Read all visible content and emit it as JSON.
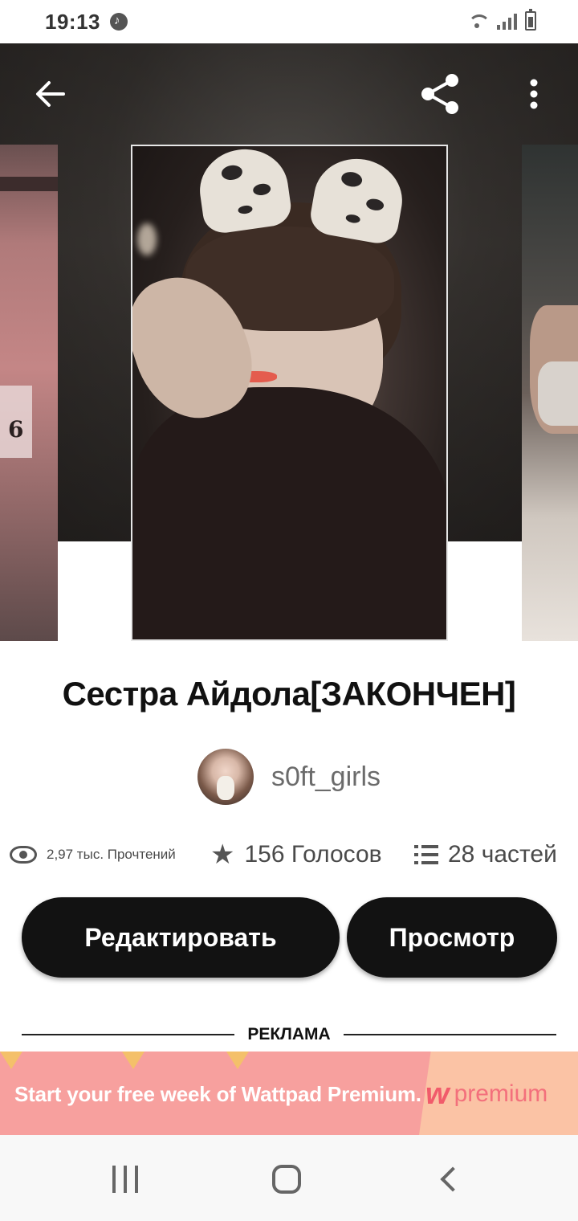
{
  "status_bar": {
    "time": "19:13"
  },
  "book": {
    "title": "Сестра Айдола[ЗАКОНЧЕН]",
    "author": "s0ft_girls"
  },
  "stats": {
    "reads": "2,97 тыс. Прочтений",
    "votes": "156 Голосов",
    "parts": "28 частей"
  },
  "actions": {
    "edit_label": "Редактировать",
    "view_label": "Просмотр"
  },
  "ad": {
    "label": "РЕКЛАМА",
    "text": "Start your free week of Wattpad Premium.",
    "logo_w": "w",
    "logo_text": "premium"
  },
  "icons": {
    "back": "arrow-left-icon",
    "share": "share-icon",
    "more": "more-vertical-icon",
    "eye": "eye-icon",
    "star": "star-icon",
    "list": "list-icon"
  },
  "colors": {
    "button_bg": "#121212",
    "ad_bg": "#f7a09e",
    "ad_logo": "#f15b6b"
  }
}
